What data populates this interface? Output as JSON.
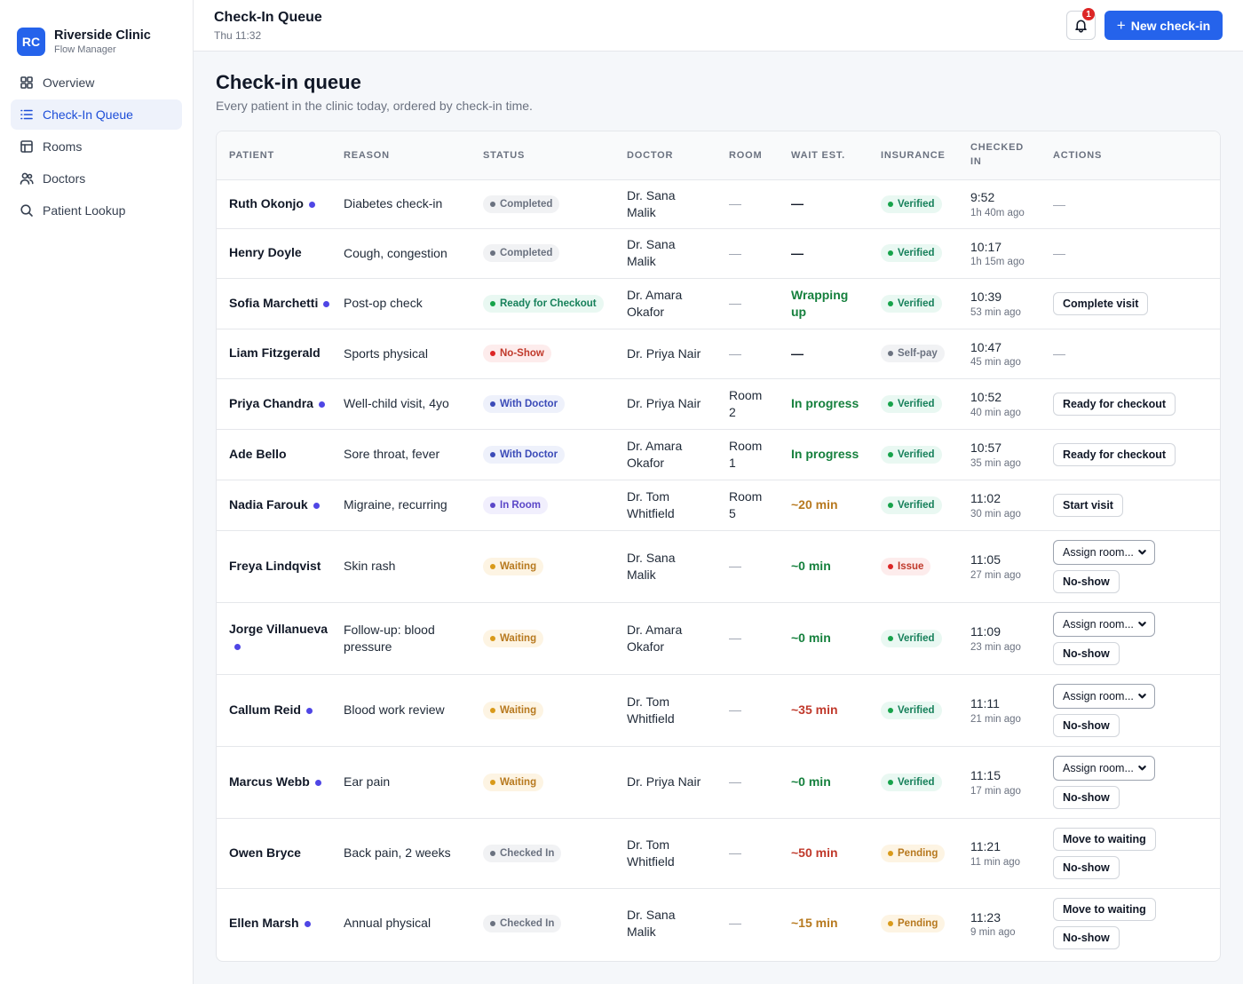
{
  "brand": {
    "logo": "RC",
    "name": "Riverside Clinic",
    "sub": "Flow Manager"
  },
  "nav": [
    {
      "label": "Overview",
      "icon": "grid-icon"
    },
    {
      "label": "Check-In Queue",
      "icon": "list-icon",
      "active": true
    },
    {
      "label": "Rooms",
      "icon": "layout-icon"
    },
    {
      "label": "Doctors",
      "icon": "users-icon"
    },
    {
      "label": "Patient Lookup",
      "icon": "search-icon"
    }
  ],
  "header": {
    "title": "Check-In Queue",
    "subtitle": "Thu 11:32",
    "notifications": "1",
    "new_button": "New check-in"
  },
  "main": {
    "title": "Check-in queue",
    "subtitle": "Every patient in the clinic today, ordered by check-in time."
  },
  "table": {
    "columns": [
      "PATIENT",
      "REASON",
      "STATUS",
      "DOCTOR",
      "ROOM",
      "WAIT EST.",
      "INSURANCE",
      "CHECKED IN",
      "ACTIONS"
    ],
    "rows": [
      {
        "patient": "Ruth Okonjo",
        "dot": true,
        "reason": "Diabetes check-in",
        "status": "Completed",
        "doctor": "Dr. Sana Malik",
        "room": "—",
        "wait": "—",
        "insurance": "Verified",
        "time": "9:52",
        "ago": "1h 40m ago",
        "actions": "—"
      },
      {
        "patient": "Henry Doyle",
        "dot": false,
        "reason": "Cough, congestion",
        "status": "Completed",
        "doctor": "Dr. Sana Malik",
        "room": "—",
        "wait": "—",
        "insurance": "Verified",
        "time": "10:17",
        "ago": "1h 15m ago",
        "actions": "—"
      },
      {
        "patient": "Sofia Marchetti",
        "dot": true,
        "reason": "Post-op check",
        "status": "Ready for Checkout",
        "doctor": "Dr. Amara Okafor",
        "room": "—",
        "wait": "Wrapping up",
        "insurance": "Verified",
        "time": "10:39",
        "ago": "53 min ago",
        "action1": "Complete visit"
      },
      {
        "patient": "Liam Fitzgerald",
        "dot": false,
        "reason": "Sports physical",
        "status": "No-Show",
        "doctor": "Dr. Priya Nair",
        "room": "—",
        "wait": "—",
        "insurance": "Self-pay",
        "time": "10:47",
        "ago": "45 min ago",
        "actions": "—"
      },
      {
        "patient": "Priya Chandra",
        "dot": true,
        "reason": "Well-child visit, 4yo",
        "status": "With Doctor",
        "doctor": "Dr. Priya Nair",
        "room": "Room 2",
        "wait": "In progress",
        "insurance": "Verified",
        "time": "10:52",
        "ago": "40 min ago",
        "action1": "Ready for checkout"
      },
      {
        "patient": "Ade Bello",
        "dot": false,
        "reason": "Sore throat, fever",
        "status": "With Doctor",
        "doctor": "Dr. Amara Okafor",
        "room": "Room 1",
        "wait": "In progress",
        "insurance": "Verified",
        "time": "10:57",
        "ago": "35 min ago",
        "action1": "Ready for checkout"
      },
      {
        "patient": "Nadia Farouk",
        "dot": true,
        "reason": "Migraine, recurring",
        "status": "In Room",
        "doctor": "Dr. Tom Whitfield",
        "room": "Room 5",
        "wait": "~20 min",
        "insurance": "Verified",
        "time": "11:02",
        "ago": "30 min ago",
        "action1": "Start visit"
      },
      {
        "patient": "Freya Lindqvist",
        "dot": false,
        "reason": "Skin rash",
        "status": "Waiting",
        "doctor": "Dr. Sana Malik",
        "room": "—",
        "wait": "~0 min",
        "insurance": "Issue",
        "time": "11:05",
        "ago": "27 min ago",
        "select": "Assign room...",
        "action2": "No-show"
      },
      {
        "patient": "Jorge Villanueva",
        "dot": true,
        "reason": "Follow-up: blood pressure",
        "status": "Waiting",
        "doctor": "Dr. Amara Okafor",
        "room": "—",
        "wait": "~0 min",
        "insurance": "Verified",
        "time": "11:09",
        "ago": "23 min ago",
        "select": "Assign room...",
        "action2": "No-show"
      },
      {
        "patient": "Callum Reid",
        "dot": true,
        "reason": "Blood work review",
        "status": "Waiting",
        "doctor": "Dr. Tom Whitfield",
        "room": "—",
        "wait": "~35 min",
        "insurance": "Verified",
        "time": "11:11",
        "ago": "21 min ago",
        "select": "Assign room...",
        "action2": "No-show"
      },
      {
        "patient": "Marcus Webb",
        "dot": true,
        "reason": "Ear pain",
        "status": "Waiting",
        "doctor": "Dr. Priya Nair",
        "room": "—",
        "wait": "~0 min",
        "insurance": "Verified",
        "time": "11:15",
        "ago": "17 min ago",
        "select": "Assign room...",
        "action2": "No-show"
      },
      {
        "patient": "Owen Bryce",
        "dot": false,
        "reason": "Back pain, 2 weeks",
        "status": "Checked In",
        "doctor": "Dr. Tom Whitfield",
        "room": "—",
        "wait": "~50 min",
        "insurance": "Pending",
        "time": "11:21",
        "ago": "11 min ago",
        "action1": "Move to waiting",
        "action2": "No-show"
      },
      {
        "patient": "Ellen Marsh",
        "dot": true,
        "reason": "Annual physical",
        "status": "Checked In",
        "doctor": "Dr. Sana Malik",
        "room": "—",
        "wait": "~15 min",
        "insurance": "Pending",
        "time": "11:23",
        "ago": "9 min ago",
        "action1": "Move to waiting",
        "action2": "No-show"
      }
    ]
  },
  "colors": {
    "accent": "#2563eb",
    "unread_dot": "#4f46e5",
    "danger": "#dc2626"
  }
}
